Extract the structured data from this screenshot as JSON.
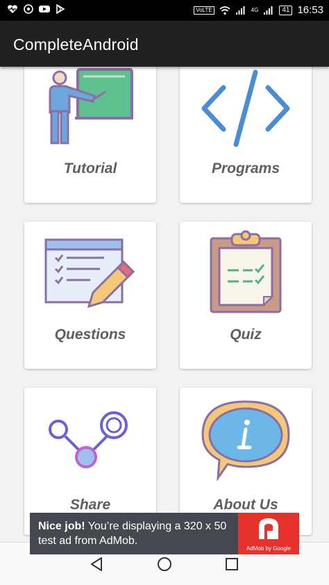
{
  "status_bar": {
    "volte": "VoLTE",
    "network": "4G",
    "battery": "41",
    "time": "16:53"
  },
  "app_bar": {
    "title": "CompleteAndroid"
  },
  "cards": [
    {
      "label": "Tutorial",
      "icon": "teacher-board-icon"
    },
    {
      "label": "Programs",
      "icon": "code-icon"
    },
    {
      "label": "Questions",
      "icon": "checklist-pencil-icon"
    },
    {
      "label": "Quiz",
      "icon": "clipboard-icon"
    },
    {
      "label": "Share",
      "icon": "share-icon"
    },
    {
      "label": "About Us",
      "icon": "info-bubble-icon"
    }
  ],
  "ad": {
    "headline": "Nice job!",
    "body": " You’re displaying a 320 x 50 test ad from AdMob.",
    "brand": "AdMob by Google"
  },
  "colors": {
    "app_bar": "#212121",
    "ad_bg": "#45494f",
    "ad_brand": "#e6322c"
  }
}
